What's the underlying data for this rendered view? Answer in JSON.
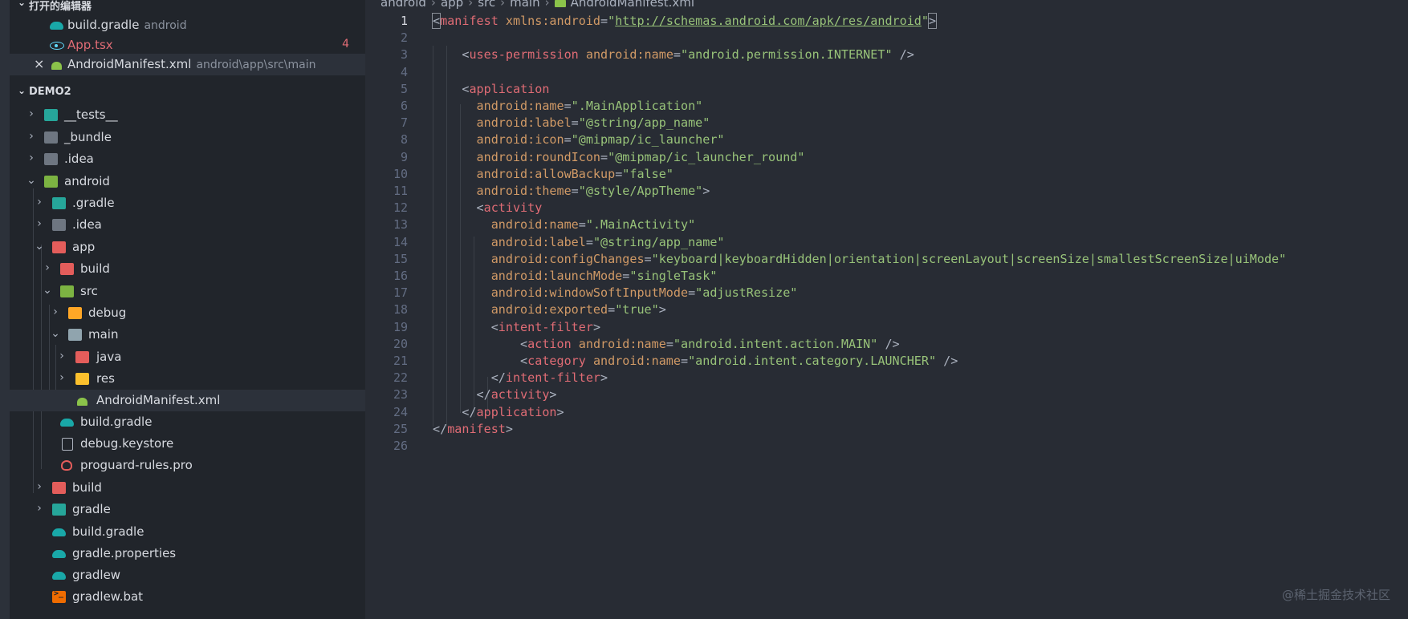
{
  "open_editors": {
    "title": "打开的编辑器",
    "items": [
      {
        "name": "build.gradle",
        "hint": "android",
        "icon": "gradle-icon"
      },
      {
        "name": "App.tsx",
        "badge": "4",
        "icon": "react-icon"
      },
      {
        "name": "AndroidManifest.xml",
        "hint": "android\\app\\src\\main",
        "icon": "android-icon",
        "active": true
      }
    ]
  },
  "explorer": {
    "project": "DEMO2",
    "tree": [
      {
        "name": "__tests__",
        "icon": "folder-tests-icon",
        "expanded": false
      },
      {
        "name": "_bundle",
        "icon": "folder-icon",
        "expanded": false
      },
      {
        "name": ".idea",
        "icon": "folder-idea-icon",
        "expanded": false
      },
      {
        "name": "android",
        "icon": "folder-android-icon",
        "expanded": true
      },
      {
        "name": ".gradle",
        "icon": "folder-gradle-icon",
        "expanded": false
      },
      {
        "name": ".idea",
        "icon": "folder-idea-icon",
        "expanded": false
      },
      {
        "name": "app",
        "icon": "folder-app-icon",
        "expanded": true
      },
      {
        "name": "build",
        "icon": "folder-build-icon",
        "expanded": false
      },
      {
        "name": "src",
        "icon": "folder-src-icon",
        "expanded": true
      },
      {
        "name": "debug",
        "icon": "folder-debug-icon",
        "expanded": false
      },
      {
        "name": "main",
        "icon": "folder-open-icon",
        "expanded": true
      },
      {
        "name": "java",
        "icon": "folder-java-icon",
        "expanded": false
      },
      {
        "name": "res",
        "icon": "folder-res-icon",
        "expanded": false
      },
      {
        "name": "AndroidManifest.xml",
        "icon": "android-icon",
        "selected": true
      },
      {
        "name": "build.gradle",
        "icon": "gradle-icon"
      },
      {
        "name": "debug.keystore",
        "icon": "file-icon"
      },
      {
        "name": "proguard-rules.pro",
        "icon": "proguard-icon"
      },
      {
        "name": "build",
        "icon": "folder-build-icon",
        "expanded": false
      },
      {
        "name": "gradle",
        "icon": "folder-gradle-icon",
        "expanded": false
      },
      {
        "name": "build.gradle",
        "icon": "gradle-icon"
      },
      {
        "name": "gradle.properties",
        "icon": "gradle-icon"
      },
      {
        "name": "gradlew",
        "icon": "gradle-icon"
      },
      {
        "name": "gradlew.bat",
        "icon": "terminal-icon"
      }
    ]
  },
  "breadcrumb": [
    "android",
    "app",
    "src",
    "main",
    "AndroidManifest.xml"
  ],
  "editor": {
    "current_line": "1",
    "line_numbers": [
      "1",
      "2",
      "3",
      "4",
      "5",
      "6",
      "7",
      "8",
      "9",
      "10",
      "11",
      "12",
      "13",
      "14",
      "15",
      "16",
      "17",
      "18",
      "19",
      "20",
      "21",
      "22",
      "23",
      "24",
      "25",
      "26"
    ],
    "lines": [
      "<manifest xmlns:android=\"http://schemas.android.com/apk/res/android\">",
      "",
      "    <uses-permission android:name=\"android.permission.INTERNET\" />",
      "",
      "    <application",
      "      android:name=\".MainApplication\"",
      "      android:label=\"@string/app_name\"",
      "      android:icon=\"@mipmap/ic_launcher\"",
      "      android:roundIcon=\"@mipmap/ic_launcher_round\"",
      "      android:allowBackup=\"false\"",
      "      android:theme=\"@style/AppTheme\">",
      "      <activity",
      "        android:name=\".MainActivity\"",
      "        android:label=\"@string/app_name\"",
      "        android:configChanges=\"keyboard|keyboardHidden|orientation|screenLayout|screenSize|smallestScreenSize|uiMode\"",
      "        android:launchMode=\"singleTask\"",
      "        android:windowSoftInputMode=\"adjustResize\"",
      "        android:exported=\"true\">",
      "        <intent-filter>",
      "            <action android:name=\"android.intent.action.MAIN\" />",
      "            <category android:name=\"android.intent.category.LAUNCHER\" />",
      "        </intent-filter>",
      "      </activity>",
      "    </application>",
      "</manifest>",
      ""
    ]
  },
  "watermark": "@稀土掘金技术社区",
  "colors": {
    "sidebar_bg": "#21252b",
    "editor_bg": "#282c34",
    "tag": "#e06c75",
    "attribute": "#d19a66",
    "string": "#98c379",
    "line_number": "#636d83"
  }
}
